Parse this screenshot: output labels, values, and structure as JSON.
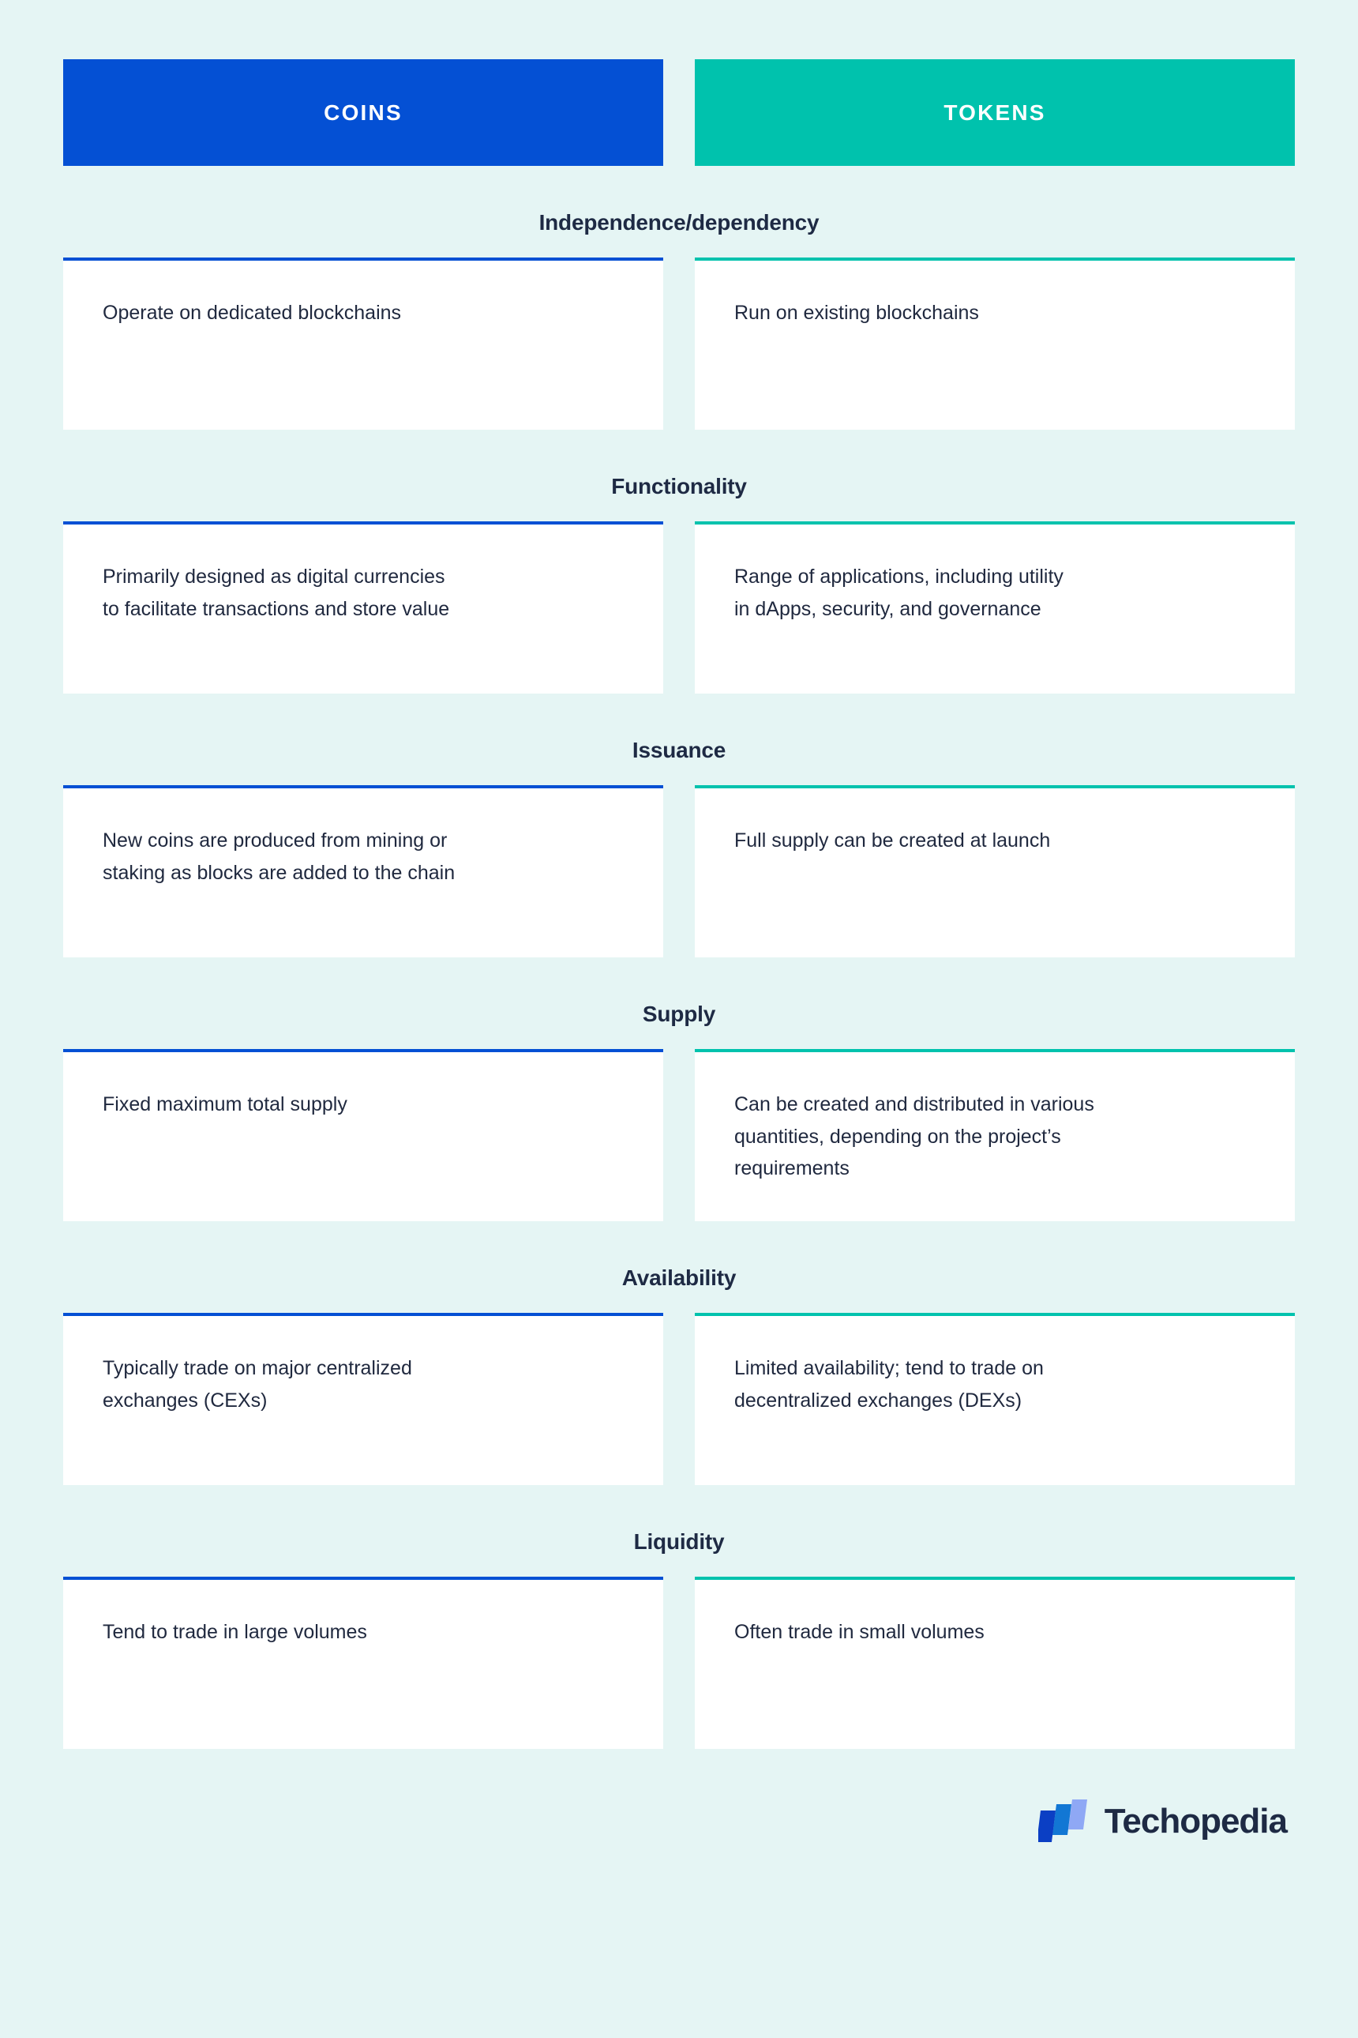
{
  "header": {
    "left_label": "COINS",
    "right_label": "TOKENS",
    "left_color": "#0450d4",
    "right_color": "#00c2ad"
  },
  "theme": {
    "background": "#e5f5f4",
    "card_background": "#ffffff",
    "heading_color": "#1e2a44",
    "body_text_color": "#20293f"
  },
  "sections": [
    {
      "title": "Independence/dependency",
      "left": "Operate on dedicated blockchains",
      "right": "Run on existing blockchains"
    },
    {
      "title": "Functionality",
      "left": "Primarily designed as digital currencies\nto facilitate transactions and store value",
      "right": "Range of applications, including utility\nin dApps, security, and governance"
    },
    {
      "title": "Issuance",
      "left": "New coins are produced from mining or\nstaking as blocks are added to the chain",
      "right": "Full supply can be created at launch"
    },
    {
      "title": "Supply",
      "left": "Fixed maximum total supply",
      "right": "Can be created and distributed in various\nquantities, depending on the project’s\nrequirements"
    },
    {
      "title": "Availability",
      "left": "Typically trade on major centralized\nexchanges (CEXs)",
      "right": "Limited availability; tend to trade on\ndecentralized exchanges (DEXs)"
    },
    {
      "title": "Liquidity",
      "left": "Tend to trade in large volumes",
      "right": "Often trade in small volumes"
    }
  ],
  "footer": {
    "brand_name": "Techopedia",
    "logo_colors": {
      "dark": "#0b3fc4",
      "mid": "#1277d4",
      "light": "#8fa8f5"
    }
  }
}
